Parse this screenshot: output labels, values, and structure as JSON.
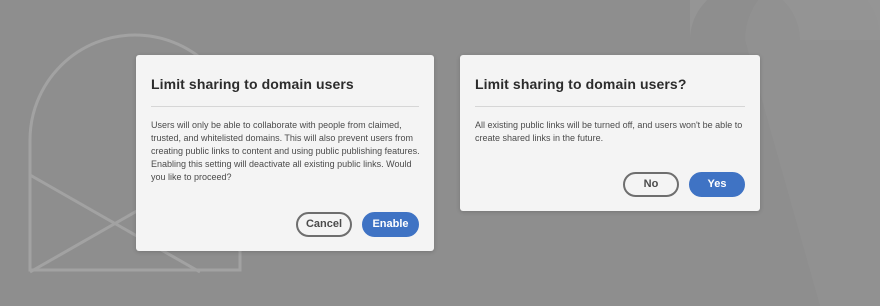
{
  "background": {
    "color": "#8e8e8e"
  },
  "dialogs": [
    {
      "title": "Limit sharing to domain users",
      "body": "Users will only be able to collaborate with people from claimed, trusted, and whitelisted domains. This will also prevent users from creating public links to content and using public publishing features. Enabling this setting will deactivate all existing public links. Would you like to proceed?",
      "secondary_label": "Cancel",
      "primary_label": "Enable"
    },
    {
      "title": "Limit sharing to domain users?",
      "body": "All existing public links will be turned off, and users won't be able to create shared links in the future.",
      "secondary_label": "No",
      "primary_label": "Yes"
    }
  ],
  "colors": {
    "accent": "#3f73c4",
    "dialog_bg": "#f4f4f4",
    "title_text": "#2c2c2c",
    "body_text": "#4b4b4b"
  }
}
